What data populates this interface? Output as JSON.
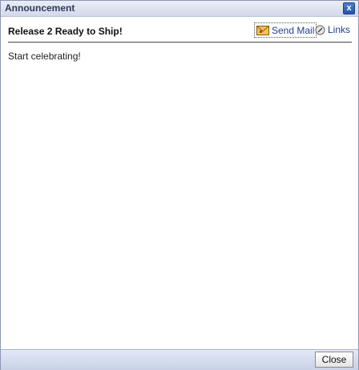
{
  "window": {
    "title": "Announcement",
    "close_glyph": "x"
  },
  "announcement": {
    "heading": "Release 2 Ready to Ship!",
    "body": "Start celebrating!"
  },
  "actions": {
    "send_mail_label": "Send Mail",
    "send_mail_icon": "envelope-icon",
    "links_label": "Links",
    "links_icon": "link-icon"
  },
  "footer": {
    "close_label": "Close"
  },
  "colors": {
    "title_bar": "#d3d9ea",
    "link_text": "#1f3f8e",
    "close_icon_bg": "#2452a6"
  }
}
